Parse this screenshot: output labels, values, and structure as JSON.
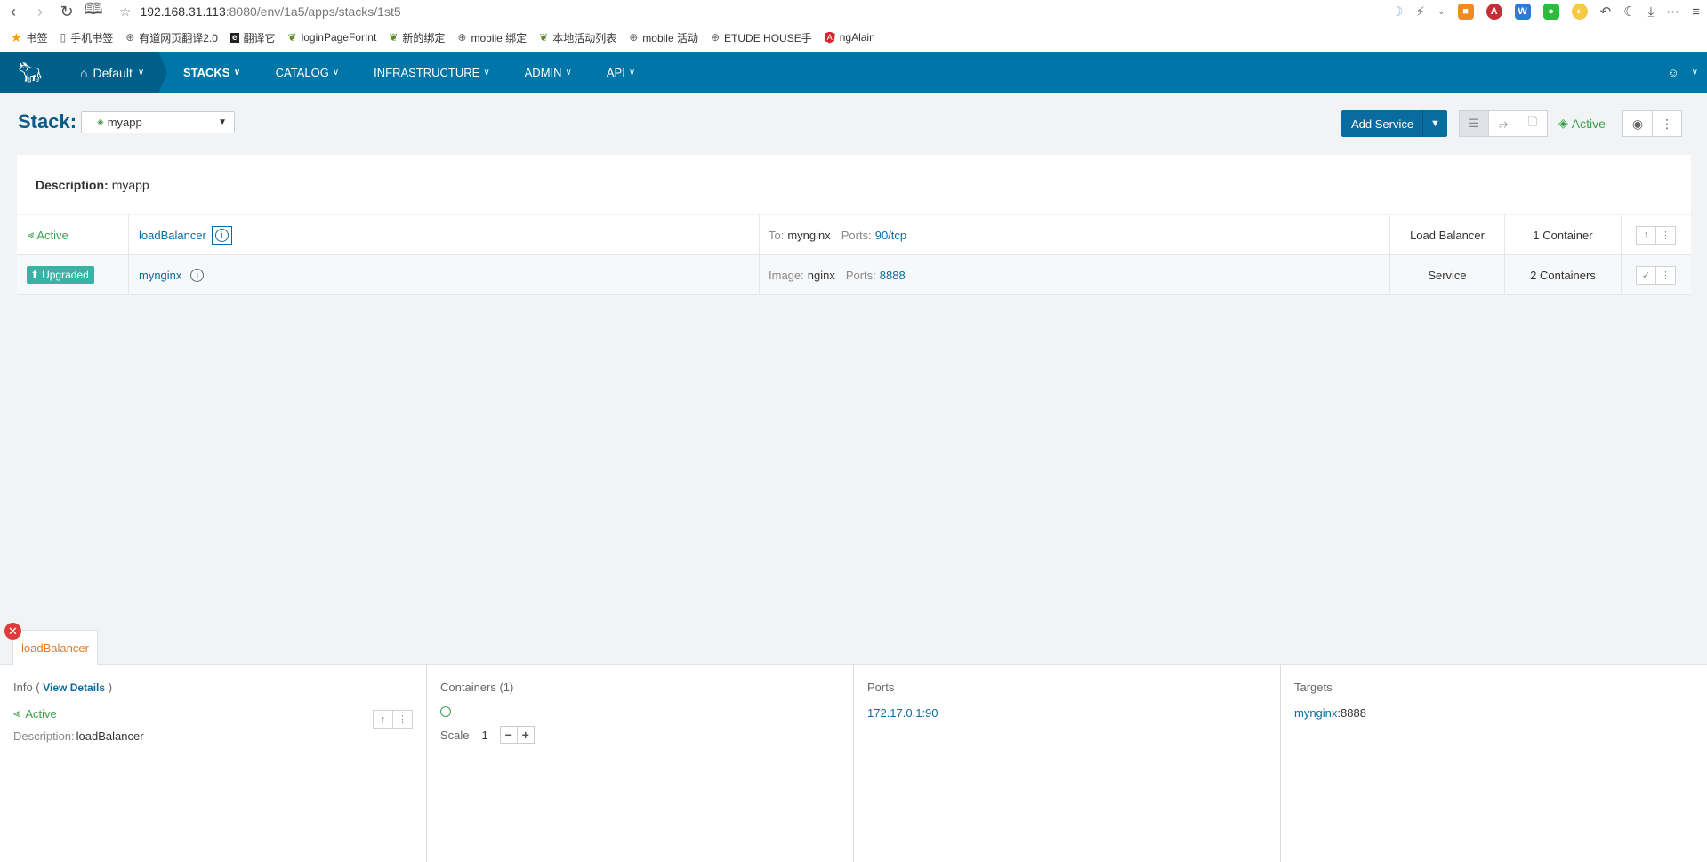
{
  "browser": {
    "url_host": "192.168.31.113",
    "url_path": ":8080/env/1a5/apps/stacks/1st5",
    "bookmarks": [
      {
        "label": "书签",
        "icon": "star-icon"
      },
      {
        "label": "手机书签",
        "icon": "phone-icon"
      },
      {
        "label": "有道网页翻译2.0",
        "icon": "globe-icon"
      },
      {
        "label": "翻译它",
        "icon": "e-icon"
      },
      {
        "label": "loginPageForInt",
        "icon": "leaf-icon"
      },
      {
        "label": "新的绑定",
        "icon": "leaf-icon"
      },
      {
        "label": "mobile 绑定",
        "icon": "globe-icon"
      },
      {
        "label": "本地活动列表",
        "icon": "leaf-icon"
      },
      {
        "label": "mobile 活动",
        "icon": "globe-icon"
      },
      {
        "label": "ETUDE HOUSE手",
        "icon": "globe-icon"
      },
      {
        "label": "ngAlain",
        "icon": "angular-icon"
      }
    ]
  },
  "header": {
    "env_label": "Default",
    "menu": [
      {
        "label": "STACKS",
        "active": true
      },
      {
        "label": "CATALOG",
        "active": false
      },
      {
        "label": "INFRASTRUCTURE",
        "active": false
      },
      {
        "label": "ADMIN",
        "active": false
      },
      {
        "label": "API",
        "active": false
      }
    ]
  },
  "stack": {
    "label": "Stack:",
    "selected": "myapp",
    "add_service": "Add Service",
    "state": "Active",
    "description_key": "Description:",
    "description_value": "myapp"
  },
  "services": [
    {
      "state": "Active",
      "name": "loadBalancer",
      "detail_key1": "To:",
      "detail_val1": "mynginx",
      "detail_key2": "Ports:",
      "detail_val2": "90/tcp",
      "kind": "Load Balancer",
      "scale": "1 Container"
    },
    {
      "state": "Upgraded",
      "name": "mynginx",
      "detail_key1": "Image:",
      "detail_val1": "nginx",
      "detail_key2": "Ports:",
      "detail_val2": "8888",
      "kind": "Service",
      "scale": "2 Containers"
    }
  ],
  "bottom": {
    "tab_label": "loadBalancer",
    "info_title": "Info (",
    "view_details": "View Details",
    "info_close": ")",
    "state": "Active",
    "desc_key": "Description:",
    "desc_value": "loadBalancer",
    "containers_title": "Containers (1)",
    "scale_label": "Scale",
    "scale_value": "1",
    "ports_title": "Ports",
    "port_value": "172.17.0.1:90",
    "targets_title": "Targets",
    "target_name": "mynginx",
    "target_port": ":8888"
  },
  "colors": {
    "brand": "#0075a8",
    "brand_dark": "#005f88",
    "active_green": "#3aa14d",
    "upgraded_teal": "#38b3a5",
    "link": "#0a6c9e",
    "tab_orange": "#e27a27"
  }
}
